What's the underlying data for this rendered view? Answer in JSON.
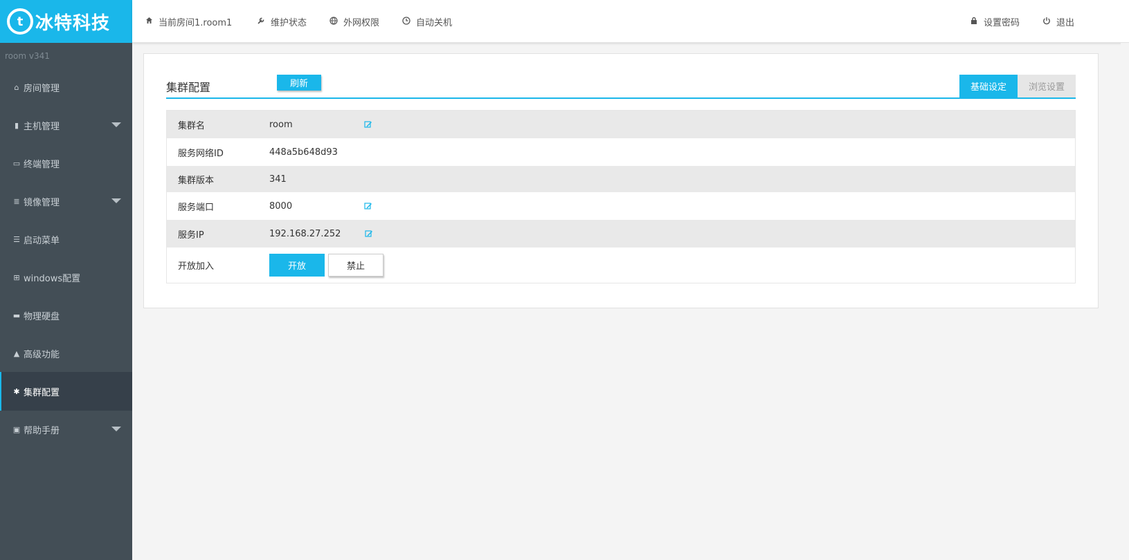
{
  "brand": {
    "badge": "t",
    "name": "冰特科技",
    "color": "#1ab7ea"
  },
  "topbar": {
    "left": [
      {
        "icon": "home-icon",
        "label": "当前房间1.room1"
      },
      {
        "icon": "wrench-icon",
        "label": "维护状态"
      },
      {
        "icon": "globe-icon",
        "label": "外网权限"
      },
      {
        "icon": "clock-icon",
        "label": "自动关机"
      }
    ],
    "right": [
      {
        "icon": "lock-icon",
        "label": "设置密码"
      },
      {
        "icon": "power-icon",
        "label": "退出"
      }
    ]
  },
  "sidebar": {
    "version": "room  v341",
    "items": [
      {
        "icon": "home-icon",
        "label": "房间管理",
        "caret": false,
        "active": false
      },
      {
        "icon": "server-icon",
        "label": "主机管理",
        "caret": true,
        "active": false
      },
      {
        "icon": "monitor-icon",
        "label": "终端管理",
        "caret": false,
        "active": false
      },
      {
        "icon": "database-icon",
        "label": "镜像管理",
        "caret": true,
        "active": false
      },
      {
        "icon": "list-icon",
        "label": "启动菜单",
        "caret": false,
        "active": false
      },
      {
        "icon": "windows-icon",
        "label": "windows配置",
        "caret": false,
        "active": false
      },
      {
        "icon": "hdd-icon",
        "label": "物理硬盘",
        "caret": false,
        "active": false
      },
      {
        "icon": "warning-icon",
        "label": "高级功能",
        "caret": false,
        "active": false
      },
      {
        "icon": "gear-icon",
        "label": "集群配置",
        "caret": false,
        "active": true
      },
      {
        "icon": "book-icon",
        "label": "帮助手册",
        "caret": true,
        "active": false
      }
    ]
  },
  "main": {
    "title": "集群配置",
    "refresh_label": "刷新",
    "tabs": [
      {
        "label": "基础设定",
        "active": true
      },
      {
        "label": "浏览设置",
        "active": false
      }
    ],
    "rows": [
      {
        "label": "集群名",
        "value": "room",
        "editable": true
      },
      {
        "label": "服务网络ID",
        "value": "448a5b648d93",
        "editable": false
      },
      {
        "label": "集群版本",
        "value": "341",
        "editable": false
      },
      {
        "label": "服务端口",
        "value": "8000",
        "editable": true
      },
      {
        "label": "服务IP",
        "value": "192.168.27.252",
        "editable": true
      }
    ],
    "join": {
      "label": "开放加入",
      "open_label": "开放",
      "deny_label": "禁止"
    }
  }
}
